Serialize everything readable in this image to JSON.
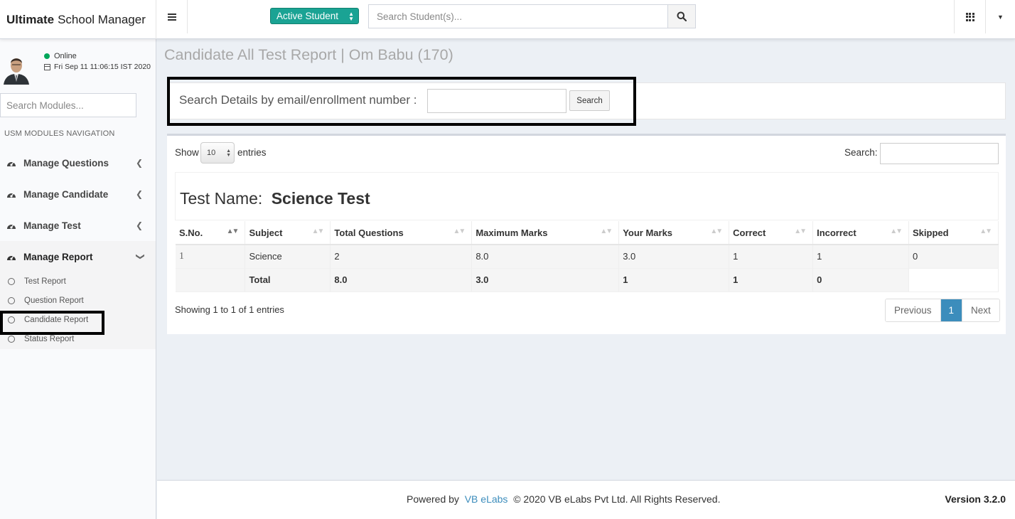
{
  "header": {
    "logo_bold": "Ultimate",
    "logo_rest": "School Manager",
    "active_student_label": "Active Student",
    "search_placeholder": "Search Student(s)..."
  },
  "sidebar": {
    "status": "Online",
    "datetime": "Fri Sep 11 11:06:15 IST 2020",
    "module_search_placeholder": "Search Modules...",
    "nav_header": "USM MODULES NAVIGATION",
    "items": [
      {
        "label": "Manage Questions",
        "icon": "dashboard-icon",
        "chevron": "chevron-left-icon"
      },
      {
        "label": "Manage Candidate",
        "icon": "dashboard-icon",
        "chevron": "chevron-left-icon"
      },
      {
        "label": "Manage Test",
        "icon": "dashboard-icon",
        "chevron": "chevron-left-icon"
      },
      {
        "label": "Manage Report",
        "icon": "dashboard-icon",
        "chevron": "chevron-down-icon"
      }
    ],
    "report_subitems": [
      "Test Report",
      "Question Report",
      "Candidate Report",
      "Status Report"
    ]
  },
  "main": {
    "page_title": "Candidate All Test Report | Om Babu (170)",
    "search_label": "Search Details by email/enrollment number :",
    "search_button": "Search",
    "show_label": "Show",
    "page_length": "10",
    "entries_label": "entries",
    "filter_label": "Search:",
    "caption_prefix": "Test Name:",
    "caption_name": "Science Test",
    "columns": [
      "S.No.",
      "Subject",
      "Total Questions",
      "Maximum Marks",
      "Your Marks",
      "Correct",
      "Incorrect",
      "Skipped"
    ],
    "rows": [
      [
        "1",
        "Science",
        "2",
        "8.0",
        "3.0",
        "1",
        "1",
        "0"
      ]
    ],
    "total_row": [
      "",
      "Total",
      "8.0",
      "3.0",
      "1",
      "1",
      "0",
      ""
    ],
    "info": "Showing 1 to 1 of 1 entries",
    "pager": {
      "previous": "Previous",
      "current": "1",
      "next": "Next"
    }
  },
  "footer": {
    "powered_by": "Powered by",
    "company_link": "VB eLabs",
    "copyright": "© 2020 VB eLabs Pvt Ltd. All Rights Reserved.",
    "version": "Version 3.2.0"
  },
  "colors": {
    "accent": "#3c8dbc",
    "active_student": "#1aa394",
    "online": "#00a65a"
  }
}
